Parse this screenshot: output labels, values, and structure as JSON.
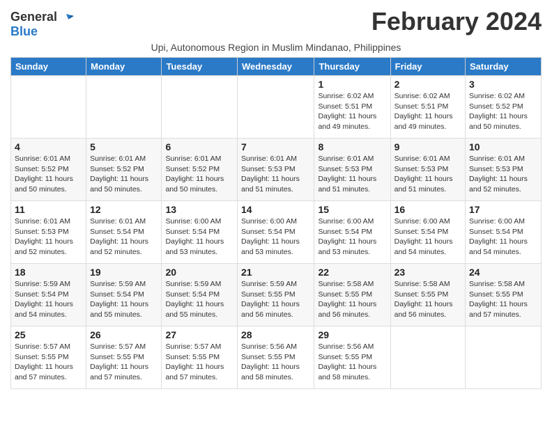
{
  "logo": {
    "general": "General",
    "blue": "Blue"
  },
  "title": "February 2024",
  "subtitle": "Upi, Autonomous Region in Muslim Mindanao, Philippines",
  "days_of_week": [
    "Sunday",
    "Monday",
    "Tuesday",
    "Wednesday",
    "Thursday",
    "Friday",
    "Saturday"
  ],
  "weeks": [
    [
      {
        "day": "",
        "content": ""
      },
      {
        "day": "",
        "content": ""
      },
      {
        "day": "",
        "content": ""
      },
      {
        "day": "",
        "content": ""
      },
      {
        "day": "1",
        "content": "Sunrise: 6:02 AM\nSunset: 5:51 PM\nDaylight: 11 hours\nand 49 minutes."
      },
      {
        "day": "2",
        "content": "Sunrise: 6:02 AM\nSunset: 5:51 PM\nDaylight: 11 hours\nand 49 minutes."
      },
      {
        "day": "3",
        "content": "Sunrise: 6:02 AM\nSunset: 5:52 PM\nDaylight: 11 hours\nand 50 minutes."
      }
    ],
    [
      {
        "day": "4",
        "content": "Sunrise: 6:01 AM\nSunset: 5:52 PM\nDaylight: 11 hours\nand 50 minutes."
      },
      {
        "day": "5",
        "content": "Sunrise: 6:01 AM\nSunset: 5:52 PM\nDaylight: 11 hours\nand 50 minutes."
      },
      {
        "day": "6",
        "content": "Sunrise: 6:01 AM\nSunset: 5:52 PM\nDaylight: 11 hours\nand 50 minutes."
      },
      {
        "day": "7",
        "content": "Sunrise: 6:01 AM\nSunset: 5:53 PM\nDaylight: 11 hours\nand 51 minutes."
      },
      {
        "day": "8",
        "content": "Sunrise: 6:01 AM\nSunset: 5:53 PM\nDaylight: 11 hours\nand 51 minutes."
      },
      {
        "day": "9",
        "content": "Sunrise: 6:01 AM\nSunset: 5:53 PM\nDaylight: 11 hours\nand 51 minutes."
      },
      {
        "day": "10",
        "content": "Sunrise: 6:01 AM\nSunset: 5:53 PM\nDaylight: 11 hours\nand 52 minutes."
      }
    ],
    [
      {
        "day": "11",
        "content": "Sunrise: 6:01 AM\nSunset: 5:53 PM\nDaylight: 11 hours\nand 52 minutes."
      },
      {
        "day": "12",
        "content": "Sunrise: 6:01 AM\nSunset: 5:54 PM\nDaylight: 11 hours\nand 52 minutes."
      },
      {
        "day": "13",
        "content": "Sunrise: 6:00 AM\nSunset: 5:54 PM\nDaylight: 11 hours\nand 53 minutes."
      },
      {
        "day": "14",
        "content": "Sunrise: 6:00 AM\nSunset: 5:54 PM\nDaylight: 11 hours\nand 53 minutes."
      },
      {
        "day": "15",
        "content": "Sunrise: 6:00 AM\nSunset: 5:54 PM\nDaylight: 11 hours\nand 53 minutes."
      },
      {
        "day": "16",
        "content": "Sunrise: 6:00 AM\nSunset: 5:54 PM\nDaylight: 11 hours\nand 54 minutes."
      },
      {
        "day": "17",
        "content": "Sunrise: 6:00 AM\nSunset: 5:54 PM\nDaylight: 11 hours\nand 54 minutes."
      }
    ],
    [
      {
        "day": "18",
        "content": "Sunrise: 5:59 AM\nSunset: 5:54 PM\nDaylight: 11 hours\nand 54 minutes."
      },
      {
        "day": "19",
        "content": "Sunrise: 5:59 AM\nSunset: 5:54 PM\nDaylight: 11 hours\nand 55 minutes."
      },
      {
        "day": "20",
        "content": "Sunrise: 5:59 AM\nSunset: 5:54 PM\nDaylight: 11 hours\nand 55 minutes."
      },
      {
        "day": "21",
        "content": "Sunrise: 5:59 AM\nSunset: 5:55 PM\nDaylight: 11 hours\nand 56 minutes."
      },
      {
        "day": "22",
        "content": "Sunrise: 5:58 AM\nSunset: 5:55 PM\nDaylight: 11 hours\nand 56 minutes."
      },
      {
        "day": "23",
        "content": "Sunrise: 5:58 AM\nSunset: 5:55 PM\nDaylight: 11 hours\nand 56 minutes."
      },
      {
        "day": "24",
        "content": "Sunrise: 5:58 AM\nSunset: 5:55 PM\nDaylight: 11 hours\nand 57 minutes."
      }
    ],
    [
      {
        "day": "25",
        "content": "Sunrise: 5:57 AM\nSunset: 5:55 PM\nDaylight: 11 hours\nand 57 minutes."
      },
      {
        "day": "26",
        "content": "Sunrise: 5:57 AM\nSunset: 5:55 PM\nDaylight: 11 hours\nand 57 minutes."
      },
      {
        "day": "27",
        "content": "Sunrise: 5:57 AM\nSunset: 5:55 PM\nDaylight: 11 hours\nand 57 minutes."
      },
      {
        "day": "28",
        "content": "Sunrise: 5:56 AM\nSunset: 5:55 PM\nDaylight: 11 hours\nand 58 minutes."
      },
      {
        "day": "29",
        "content": "Sunrise: 5:56 AM\nSunset: 5:55 PM\nDaylight: 11 hours\nand 58 minutes."
      },
      {
        "day": "",
        "content": ""
      },
      {
        "day": "",
        "content": ""
      }
    ]
  ]
}
